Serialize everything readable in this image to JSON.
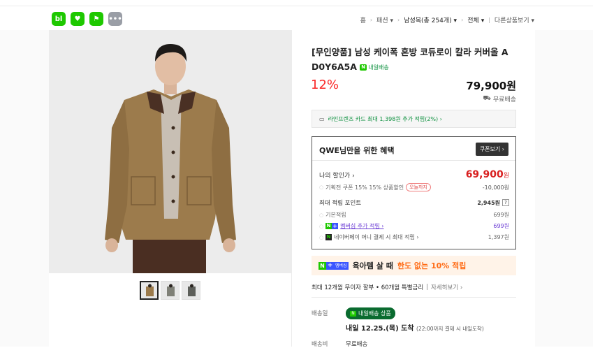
{
  "apps": [
    {
      "label": "bl",
      "color": "#1ec800"
    },
    {
      "label": "♥",
      "color": "#1ec800"
    },
    {
      "label": "⚑",
      "color": "#1ec800"
    },
    {
      "label": "•••",
      "color": "#9a9ea6"
    }
  ],
  "breadcrumb": {
    "home": "홈",
    "cat1": "패션",
    "cat2": "남성복(총 254개)",
    "cat3": "전체",
    "more": "다른상품보기"
  },
  "product": {
    "title_line1": "[무인양품] 남성 케이폭 혼방 코듀로이 칼라 커버올 A",
    "title_line2": "D0Y6A5A",
    "tomorrow_badge": "내일배송",
    "discount": "12%",
    "price": "79,900원",
    "shipping_free": "무료배송",
    "card_banner": "라인프렌즈 카드 최대 1,398원 추가 적립(2%) ›"
  },
  "benefit": {
    "heading": "QWE님만을 위한 혜택",
    "coupon_button": "쿠폰보기 ›",
    "my_price_label": "나의 할인가 ›",
    "my_price": "69,900",
    "my_price_unit": "원",
    "coupon_desc": "기획전 쿠폰 15% 15% 상품할인",
    "coupon_tag": "오늘까지",
    "coupon_amount": "-10,000원",
    "points_label": "최대 적립 포인트",
    "points_total": "2,945원",
    "points_help": "?",
    "basic_label": "기본적립",
    "basic_val": "699원",
    "membership_label": "멤버십 추가 적립 ›",
    "membership_val": "699원",
    "npay_label": "네이버페이 머니 결제 시 최대 적립 ›",
    "npay_val": "1,397원"
  },
  "promo": {
    "badge": "멤버십",
    "text_black": "육아템 살 때",
    "text_orange": "한도 없는 10% 적립"
  },
  "installment": {
    "text": "최대 12개월 무이자 할부 • 60개월 특별금리",
    "link": "자세히보기 ›"
  },
  "delivery": {
    "label": "배송일",
    "badge": "내일배송 상품",
    "arrive": "내일 12.25.(목) 도착",
    "arrive_note": "(22:00까지 결제 시 내일도착)",
    "fee_label": "배송비",
    "fee_val": "무료배송"
  }
}
